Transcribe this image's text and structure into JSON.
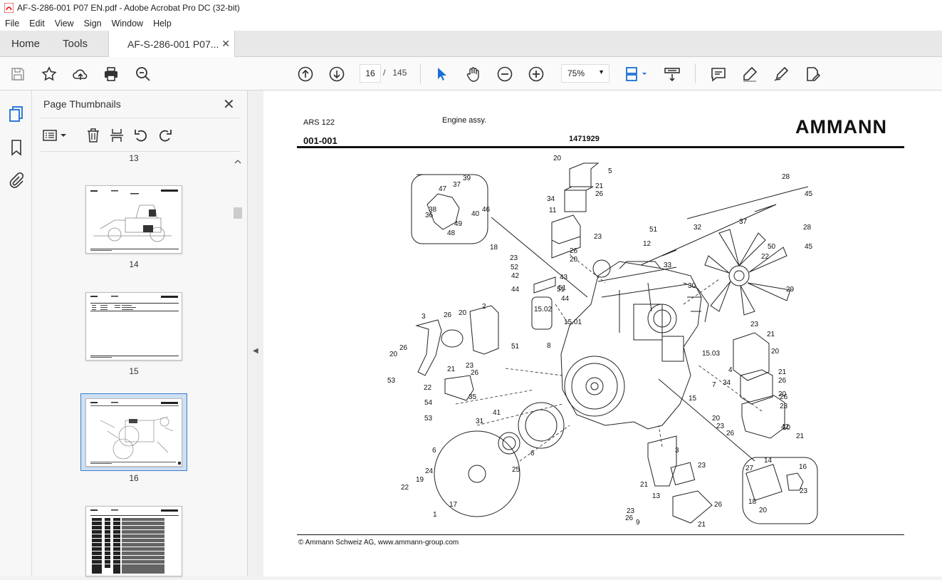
{
  "window": {
    "title": "AF-S-286-001 P07 EN.pdf - Adobe Acrobat Pro DC (32-bit)"
  },
  "menu": [
    "File",
    "Edit",
    "View",
    "Sign",
    "Window",
    "Help"
  ],
  "tabs": {
    "home": "Home",
    "tools": "Tools",
    "document": "AF-S-286-001 P07..."
  },
  "toolbar": {
    "current_page": "16",
    "page_sep": "/",
    "total_pages": "145",
    "zoom": "75%"
  },
  "panel": {
    "title": "Page Thumbnails",
    "thumbnails": [
      "13",
      "14",
      "15",
      "16"
    ]
  },
  "document": {
    "model": "ARS 122",
    "section_title": "Engine assy.",
    "brand": "AMMANN",
    "group_number": "001-001",
    "part_number": "1471929",
    "footer": "© Ammann Schweiz AG, www.ammann-group.com",
    "callouts": [
      "20",
      "5",
      "39",
      "37",
      "47",
      "46",
      "40",
      "36",
      "38",
      "49",
      "48",
      "34",
      "21",
      "26",
      "11",
      "23",
      "26",
      "20",
      "28",
      "45",
      "51",
      "32",
      "37",
      "28",
      "45",
      "18",
      "23",
      "52",
      "42",
      "43",
      "51",
      "44",
      "44",
      "15.02",
      "12",
      "33",
      "50",
      "22",
      "29",
      "30",
      "51",
      "15.01",
      "8",
      "3",
      "26",
      "20",
      "2",
      "51",
      "15.03",
      "23",
      "21",
      "20",
      "20",
      "26",
      "21",
      "23",
      "26",
      "53",
      "22",
      "54",
      "53",
      "35",
      "4",
      "21",
      "26",
      "34",
      "7",
      "15",
      "26",
      "23",
      "20",
      "20",
      "23",
      "26",
      "10",
      "21",
      "42",
      "41",
      "31",
      "6",
      "6",
      "25",
      "24",
      "19",
      "22",
      "17",
      "1",
      "3",
      "23",
      "21",
      "13",
      "14",
      "27",
      "16",
      "23",
      "18",
      "20",
      "23",
      "26",
      "9",
      "26",
      "21"
    ]
  }
}
